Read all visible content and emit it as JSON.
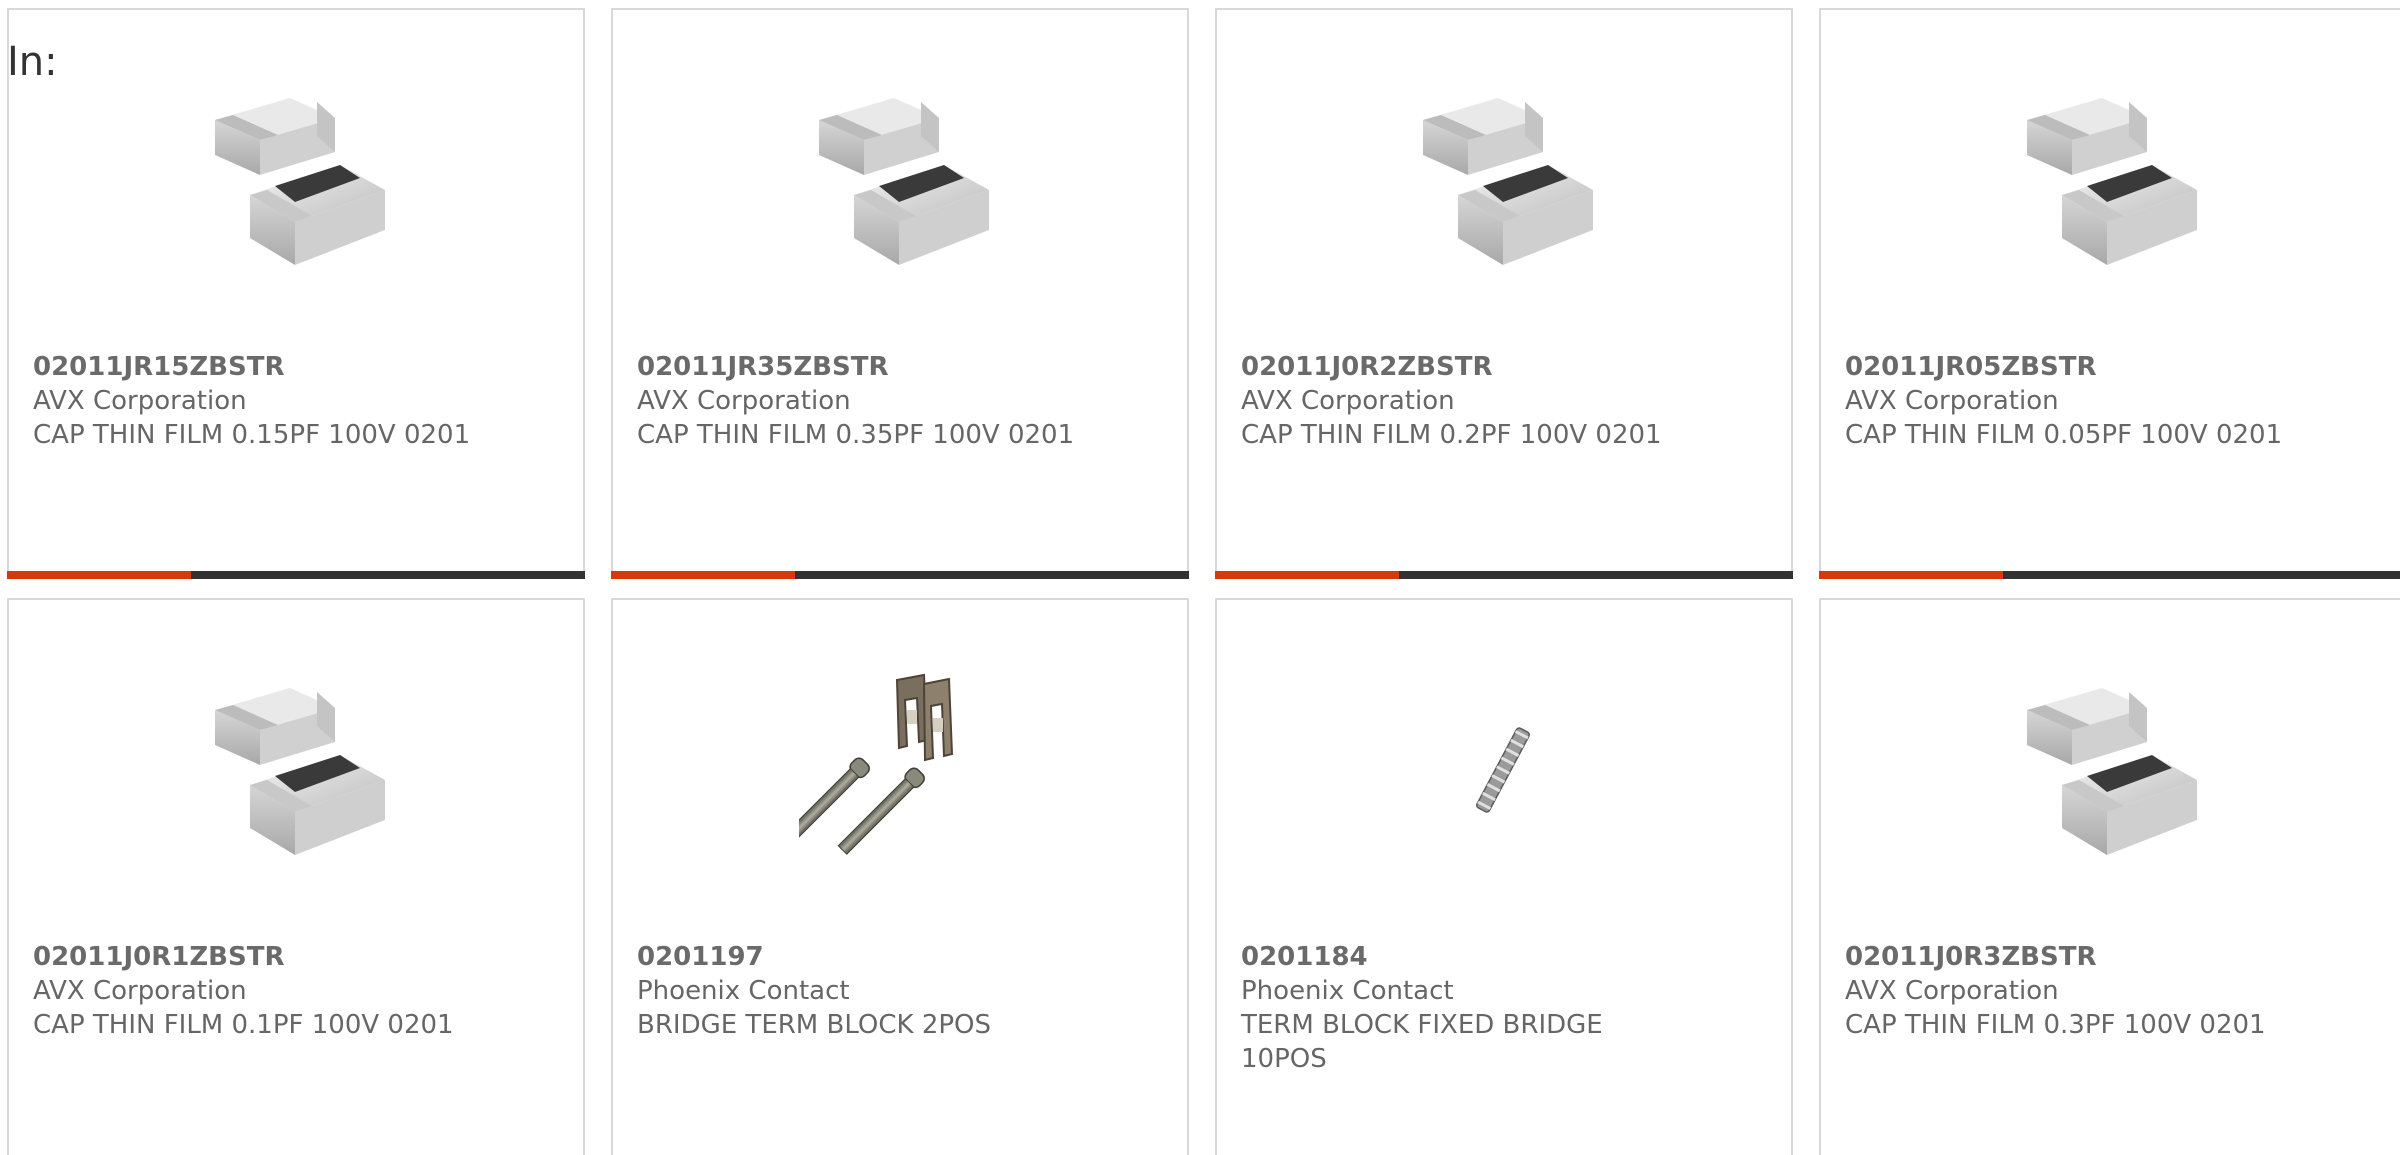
{
  "header": {
    "in_label": "In:"
  },
  "colors": {
    "accent": "#d9380d",
    "bar": "#333333",
    "border": "#d9d9d9",
    "text": "#666666"
  },
  "products": [
    {
      "part_number": "02011JR15ZBSTR",
      "manufacturer": "AVX Corporation",
      "description": "CAP THIN FILM 0.15PF 100V 0201",
      "image": "capacitor-chip-image"
    },
    {
      "part_number": "02011JR35ZBSTR",
      "manufacturer": "AVX Corporation",
      "description": "CAP THIN FILM 0.35PF 100V 0201",
      "image": "capacitor-chip-image"
    },
    {
      "part_number": "02011J0R2ZBSTR",
      "manufacturer": "AVX Corporation",
      "description": "CAP THIN FILM 0.2PF 100V 0201",
      "image": "capacitor-chip-image"
    },
    {
      "part_number": "02011JR05ZBSTR",
      "manufacturer": "AVX Corporation",
      "description": "CAP THIN FILM 0.05PF 100V 0201",
      "image": "capacitor-chip-image"
    },
    {
      "part_number": "02011J0R1ZBSTR",
      "manufacturer": "AVX Corporation",
      "description": "CAP THIN FILM 0.1PF 100V 0201",
      "image": "capacitor-chip-image"
    },
    {
      "part_number": "0201197",
      "manufacturer": "Phoenix Contact",
      "description": "BRIDGE TERM BLOCK 2POS",
      "image": "bridge-term-block-image"
    },
    {
      "part_number": "0201184",
      "manufacturer": "Phoenix Contact",
      "description": "TERM BLOCK FIXED BRIDGE 10POS",
      "image": "fixed-bridge-image"
    },
    {
      "part_number": "02011J0R3ZBSTR",
      "manufacturer": "AVX Corporation",
      "description": "CAP THIN FILM 0.3PF 100V 0201",
      "image": "capacitor-chip-image"
    }
  ]
}
